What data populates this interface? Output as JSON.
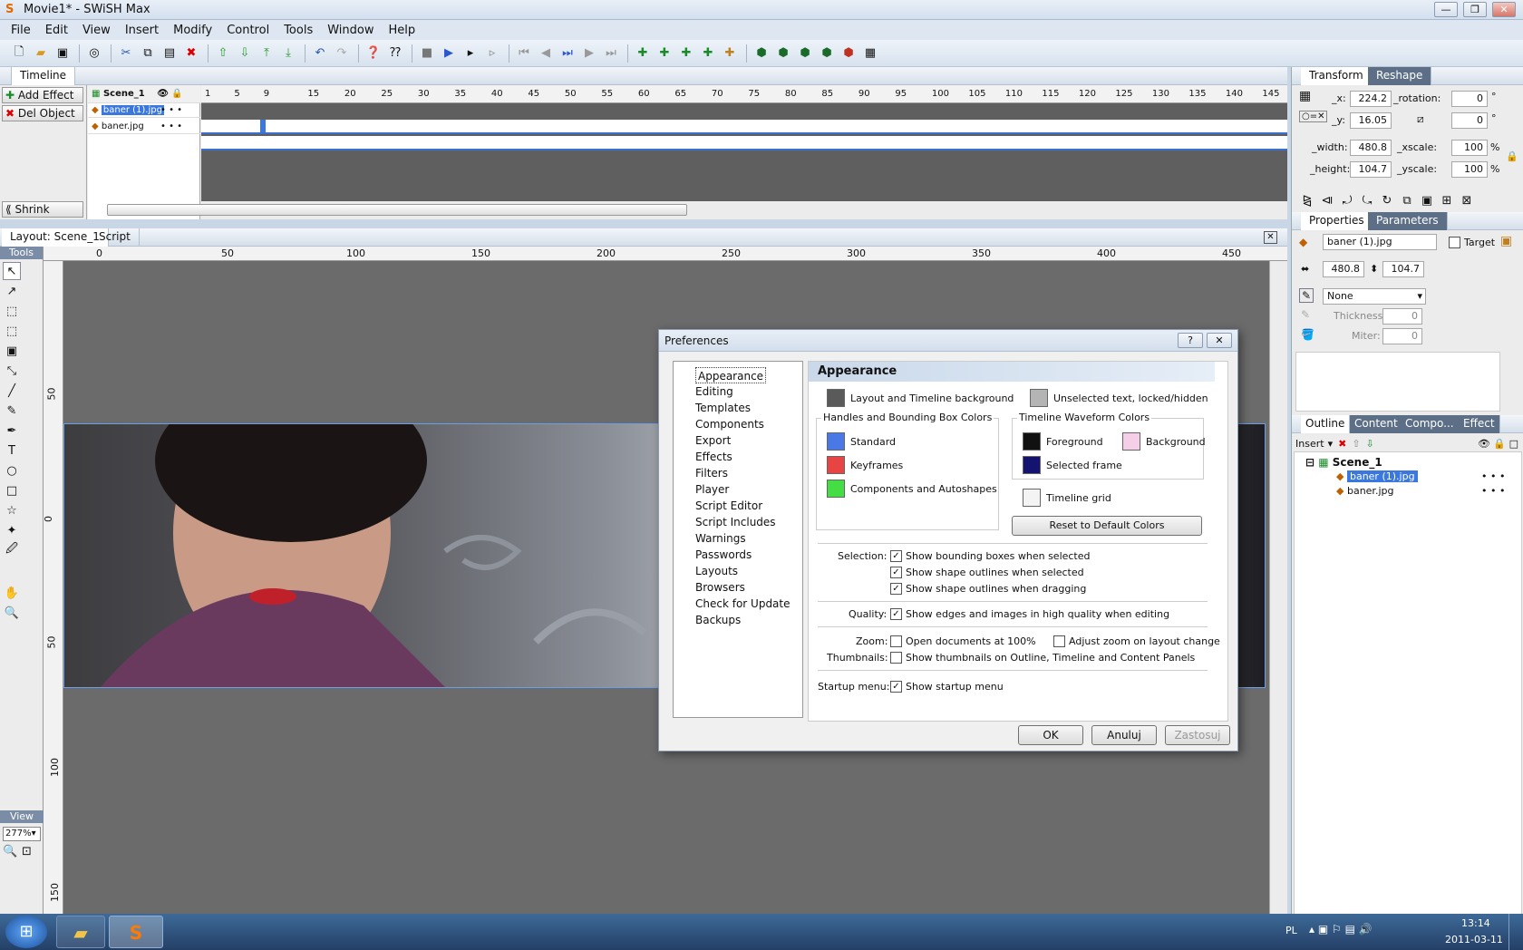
{
  "window": {
    "title": "Movie1* - SWiSH Max"
  },
  "menu": [
    "File",
    "Edit",
    "View",
    "Insert",
    "Modify",
    "Control",
    "Tools",
    "Window",
    "Help"
  ],
  "timeline": {
    "tab": "Timeline",
    "add_effect": "Add Effect",
    "del_object": "Del Object",
    "shrink": "Shrink",
    "scene": "Scene_1",
    "layers": [
      "baner (1).jpg",
      "baner.jpg"
    ],
    "ruler_ticks": [
      "1",
      "5",
      "9",
      "15",
      "20",
      "25",
      "30",
      "35",
      "40",
      "45",
      "50",
      "55",
      "60",
      "65",
      "70",
      "75",
      "80",
      "85",
      "90",
      "95",
      "100",
      "105",
      "110",
      "115",
      "120",
      "125",
      "130",
      "135",
      "140",
      "145"
    ]
  },
  "layout": {
    "tabs": [
      "Layout: Scene_1",
      "Script"
    ],
    "tools_label": "Tools",
    "view_label": "View",
    "zoom": "277%",
    "hruler": [
      "0",
      "50",
      "100",
      "150",
      "200",
      "250",
      "300",
      "350",
      "400",
      "450"
    ],
    "vruler": [
      "50",
      "0",
      "50",
      "100",
      "150"
    ]
  },
  "transform": {
    "tabs": [
      "Transform",
      "Reshape"
    ],
    "x_label": "_x:",
    "x": "224.2",
    "rotation_label": "_rotation:",
    "rotation": "0",
    "y_label": "_y:",
    "y": "16.05",
    "skew": "0",
    "width_label": "_width:",
    "width": "480.8",
    "xscale_label": "_xscale:",
    "xscale": "100",
    "height_label": "_height:",
    "height": "104.7",
    "yscale_label": "_yscale:",
    "yscale": "100",
    "pct": "%",
    "deg": "°"
  },
  "properties": {
    "tabs": [
      "Properties",
      "Parameters"
    ],
    "name": "baner (1).jpg",
    "target": "Target",
    "w": "480.8",
    "h": "104.7",
    "line_style": "None",
    "thickness_label": "Thickness:",
    "thickness": "0",
    "miter_label": "Miter:",
    "miter": "0"
  },
  "outline": {
    "tabs": [
      "Outline",
      "Content",
      "Compo...",
      "Effect"
    ],
    "insert": "Insert",
    "scene": "Scene_1",
    "items": [
      "baner (1).jpg",
      "baner.jpg"
    ]
  },
  "dialog": {
    "title": "Preferences",
    "nav": [
      "Appearance",
      "Editing",
      "Templates",
      "Components",
      "Export",
      "Effects",
      "Filters",
      "Player",
      "Script Editor",
      "Script Includes",
      "Warnings",
      "Passwords",
      "Layouts",
      "Browsers",
      "Check for Update",
      "Backups"
    ],
    "heading": "Appearance",
    "bg_label": "Layout and Timeline background",
    "unsel_label": "Unselected text, locked/hidden",
    "handles_group": "Handles and Bounding Box Colors",
    "standard": "Standard",
    "keyframes": "Keyframes",
    "components": "Components and Autoshapes",
    "waveform_group": "Timeline Waveform Colors",
    "foreground": "Foreground",
    "background": "Background",
    "selected_frame": "Selected frame",
    "timeline_grid": "Timeline grid",
    "reset": "Reset to Default Colors",
    "selection_label": "Selection:",
    "sel1": "Show bounding boxes when selected",
    "sel2": "Show shape outlines when selected",
    "sel3": "Show shape outlines when dragging",
    "quality_label": "Quality:",
    "quality": "Show edges and images in high quality when editing",
    "zoom_label": "Zoom:",
    "zoom1": "Open documents at 100%",
    "zoom2": "Adjust zoom on layout change",
    "thumb_label": "Thumbnails:",
    "thumb": "Show thumbnails on Outline, Timeline and Content Panels",
    "startup_label": "Startup menu:",
    "startup": "Show startup menu",
    "ok": "OK",
    "cancel": "Anuluj",
    "apply": "Zastosuj",
    "help": "?",
    "close": "✕",
    "colors": {
      "bg": "#5a5a5a",
      "unsel": "#b4b4b4",
      "standard": "#4a78e6",
      "keyframes": "#e84444",
      "components": "#44dd44",
      "foreground": "#111111",
      "background": "#f5cfe8",
      "selected_frame": "#141470",
      "grid": "#f4f4f4"
    }
  },
  "taskbar": {
    "lang": "PL",
    "time": "13:14",
    "date": "2011-03-11"
  }
}
